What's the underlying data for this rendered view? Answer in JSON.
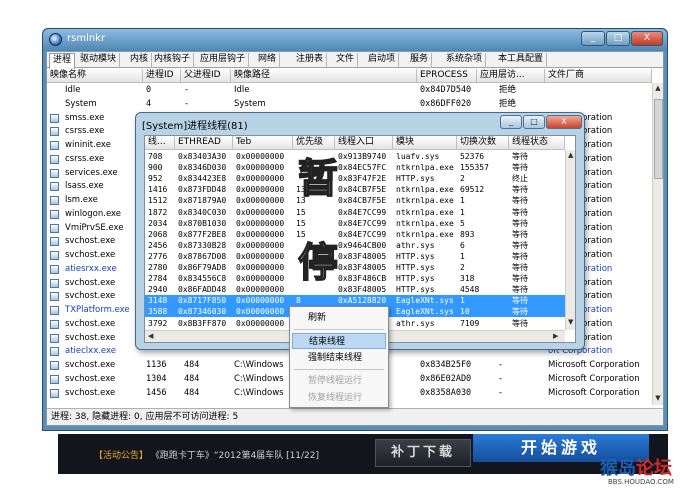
{
  "window": {
    "title": "rsmlnkr",
    "min_label": "_",
    "max_label": "□",
    "close_label": "X"
  },
  "tabs": [
    "进程",
    "驱动模块",
    "内核",
    "内核钩子",
    "应用层钩子",
    "网络",
    "注册表",
    "文件",
    "启动项",
    "服务",
    "系统杂项",
    "本工具配置"
  ],
  "main_columns": [
    "映像名称",
    "进程ID",
    "父进程ID",
    "映像路径",
    "EPROCESS",
    "应用层访...",
    "文件厂商"
  ],
  "processes": [
    {
      "name": "Idle",
      "pid": "0",
      "ppid": "-",
      "path": "Idle",
      "eprocess": "0x84D7D540",
      "access": "拒绝",
      "vendor": ""
    },
    {
      "name": "System",
      "pid": "4",
      "ppid": "-",
      "path": "System",
      "eprocess": "0x86DFF020",
      "access": "拒绝",
      "vendor": ""
    },
    {
      "name": "smss.exe",
      "pid": "",
      "ppid": "",
      "path": "",
      "eprocess": "",
      "access": "",
      "vendor": "oft Corporation"
    },
    {
      "name": "csrss.exe",
      "pid": "",
      "ppid": "",
      "path": "",
      "eprocess": "",
      "access": "",
      "vendor": "oft Corporation"
    },
    {
      "name": "wininit.exe",
      "pid": "",
      "ppid": "",
      "path": "",
      "eprocess": "",
      "access": "",
      "vendor": "oft Corporation"
    },
    {
      "name": "csrss.exe",
      "pid": "",
      "ppid": "",
      "path": "",
      "eprocess": "",
      "access": "",
      "vendor": "oft Corporation"
    },
    {
      "name": "services.exe",
      "pid": "",
      "ppid": "",
      "path": "",
      "eprocess": "",
      "access": "",
      "vendor": "oft Corporation"
    },
    {
      "name": "lsass.exe",
      "pid": "",
      "ppid": "",
      "path": "",
      "eprocess": "",
      "access": "",
      "vendor": "oft Corporation"
    },
    {
      "name": "lsm.exe",
      "pid": "",
      "ppid": "",
      "path": "",
      "eprocess": "",
      "access": "",
      "vendor": "oft Corporation"
    },
    {
      "name": "winlogon.exe",
      "pid": "",
      "ppid": "",
      "path": "",
      "eprocess": "",
      "access": "",
      "vendor": "oft Corporation"
    },
    {
      "name": "VmiPrvSE.exe",
      "pid": "",
      "ppid": "",
      "path": "",
      "eprocess": "",
      "access": "",
      "vendor": "oft Corporation"
    },
    {
      "name": "svchost.exe",
      "pid": "",
      "ppid": "",
      "path": "",
      "eprocess": "",
      "access": "",
      "vendor": "oft Corporation"
    },
    {
      "name": "svchost.exe",
      "pid": "",
      "ppid": "",
      "path": "",
      "eprocess": "",
      "access": "",
      "vendor": "oft Corporation"
    },
    {
      "name": "atiesrxx.exe",
      "pid": "",
      "ppid": "",
      "path": "",
      "eprocess": "",
      "access": "",
      "vendor": "oft Corporation",
      "blue": true
    },
    {
      "name": "svchost.exe",
      "pid": "",
      "ppid": "",
      "path": "",
      "eprocess": "",
      "access": "",
      "vendor": "oft Corporation"
    },
    {
      "name": "svchost.exe",
      "pid": "",
      "ppid": "",
      "path": "",
      "eprocess": "",
      "access": "",
      "vendor": "oft Corporation"
    },
    {
      "name": "TXPlatform.exe",
      "pid": "",
      "ppid": "",
      "path": "",
      "eprocess": "",
      "access": "",
      "vendor": "oft Corporation",
      "blue": true
    },
    {
      "name": "svchost.exe",
      "pid": "",
      "ppid": "",
      "path": "",
      "eprocess": "",
      "access": "",
      "vendor": "oft Corporation"
    },
    {
      "name": "svchost.exe",
      "pid": "",
      "ppid": "",
      "path": "",
      "eprocess": "",
      "access": "",
      "vendor": "oft Corporation"
    },
    {
      "name": "atieclxx.exe",
      "pid": "",
      "ppid": "",
      "path": "",
      "eprocess": "",
      "access": "",
      "vendor": "oft Corporation",
      "blue": true
    },
    {
      "name": "svchost.exe",
      "pid": "1136",
      "ppid": "484",
      "path": "C:\\Windows",
      "eprocess": "0x834B25F0",
      "access": "-",
      "vendor": "Microsoft Corporation"
    },
    {
      "name": "svchost.exe",
      "pid": "1304",
      "ppid": "484",
      "path": "C:\\Windows",
      "eprocess": "0x86E02AD0",
      "access": "-",
      "vendor": "Microsoft Corporation"
    },
    {
      "name": "svchost.exe",
      "pid": "1456",
      "ppid": "484",
      "path": "C:\\Windows",
      "eprocess": "0x8358A030",
      "access": "-",
      "vendor": "Microsoft Corporation"
    }
  ],
  "status": {
    "processes_label": "进程:",
    "processes": "38",
    "hidden_label": "隐藏进程:",
    "hidden": "0",
    "inaccessible_label": "应用层不可访问进程:",
    "inaccessible": "5"
  },
  "dialog": {
    "title": "[System]进程线程(81)",
    "columns": [
      "线...",
      "ETHREAD",
      "Teb",
      "优先级",
      "线程入口",
      "模块",
      "切换次数",
      "线程状态"
    ],
    "rows": [
      {
        "tid": "708",
        "ethread": "0x83403A30",
        "teb": "0x00000000",
        "prio": "",
        "entry": "0x913B9740",
        "module": "luafv.sys",
        "switches": "52376",
        "state": "等待",
        "sel": false
      },
      {
        "tid": "900",
        "ethread": "0x8346D030",
        "teb": "0x00000000",
        "prio": "",
        "entry": "0x84EC57FC",
        "module": "ntkrnlpa.exe",
        "switches": "155357",
        "state": "等待",
        "sel": false
      },
      {
        "tid": "952",
        "ethread": "0x834423E8",
        "teb": "0x00000000",
        "prio": "",
        "entry": "0x83F47F2E",
        "module": "HTTP.sys",
        "switches": "2",
        "state": "终止",
        "sel": false
      },
      {
        "tid": "1416",
        "ethread": "0x873FDD48",
        "teb": "0x00000000",
        "prio": "13",
        "entry": "0x84CB7F5E",
        "module": "ntkrnlpa.exe",
        "switches": "69512",
        "state": "等待",
        "sel": false
      },
      {
        "tid": "1512",
        "ethread": "0x871879A0",
        "teb": "0x00000000",
        "prio": "13",
        "entry": "0x84CB7F5E",
        "module": "ntkrnlpa.exe",
        "switches": "1",
        "state": "等待",
        "sel": false
      },
      {
        "tid": "1872",
        "ethread": "0x8340C030",
        "teb": "0x00000000",
        "prio": "15",
        "entry": "0x84E7CC99",
        "module": "ntkrnlpa.exe",
        "switches": "1",
        "state": "等待",
        "sel": false
      },
      {
        "tid": "2034",
        "ethread": "0x870B1030",
        "teb": "0x00000000",
        "prio": "15",
        "entry": "0x84E7CC99",
        "module": "ntkrnlpa.exe",
        "switches": "5",
        "state": "等待",
        "sel": false
      },
      {
        "tid": "2068",
        "ethread": "0x877F2BE8",
        "teb": "0x00000000",
        "prio": "15",
        "entry": "0x84E7CC99",
        "module": "ntkrnlpa.exe",
        "switches": "893",
        "state": "等待",
        "sel": false
      },
      {
        "tid": "2456",
        "ethread": "0x87330B28",
        "teb": "0x00000000",
        "prio": "",
        "entry": "0x9464CB00",
        "module": "athr.sys",
        "switches": "6",
        "state": "等待",
        "sel": false
      },
      {
        "tid": "2776",
        "ethread": "0x87867D08",
        "teb": "0x00000000",
        "prio": "",
        "entry": "0x83F48005",
        "module": "HTTP.sys",
        "switches": "1",
        "state": "等待",
        "sel": false
      },
      {
        "tid": "2780",
        "ethread": "0x86F79AD8",
        "teb": "0x00000000",
        "prio": "",
        "entry": "0x83F48005",
        "module": "HTTP.sys",
        "switches": "2",
        "state": "等待",
        "sel": false
      },
      {
        "tid": "2784",
        "ethread": "0x834556C8",
        "teb": "0x00000000",
        "prio": "",
        "entry": "0x83F486CB",
        "module": "HTTP.sys",
        "switches": "318",
        "state": "等待",
        "sel": false
      },
      {
        "tid": "2940",
        "ethread": "0x86FADD48",
        "teb": "0x00000000",
        "prio": "",
        "entry": "0x83F48005",
        "module": "HTTP.sys",
        "switches": "4548",
        "state": "等待",
        "sel": false
      },
      {
        "tid": "3148",
        "ethread": "0x8717F850",
        "teb": "0x00000000",
        "prio": "8",
        "entry": "0xA5128820",
        "module": "EagleXNt.sys",
        "switches": "1",
        "state": "等待",
        "sel": true
      },
      {
        "tid": "3588",
        "ethread": "0x87346030",
        "teb": "0x00000000",
        "prio": "8",
        "entry": "0xA51A2AA0",
        "module": "EagleXNt.sys",
        "switches": "10",
        "state": "等待",
        "sel": true
      },
      {
        "tid": "3792",
        "ethread": "0x8B3FF870",
        "teb": "0x00000000",
        "prio": "",
        "entry": "",
        "module": "athr.sys",
        "switches": "7109",
        "state": "等待",
        "sel": false
      }
    ]
  },
  "context_menu": {
    "refresh": "刷新",
    "end_thread": "结束线程",
    "force_end_thread": "强制结束线程",
    "suspend_thread": "暂停线程运行",
    "resume_thread": "恢复线程运行"
  },
  "watermark": {
    "char1": "暂",
    "char2": "停"
  },
  "banner": {
    "news_tag": "【活动公告】",
    "news_text": "《跑跑卡丁车》“2012第4届车队",
    "news_page": "[11/22]",
    "patch_button": "补丁下载",
    "start_button": "开始游戏"
  },
  "site": {
    "name_a": "猴岛",
    "name_b": "论坛",
    "url": "BBS.HOUDAO.COM"
  }
}
